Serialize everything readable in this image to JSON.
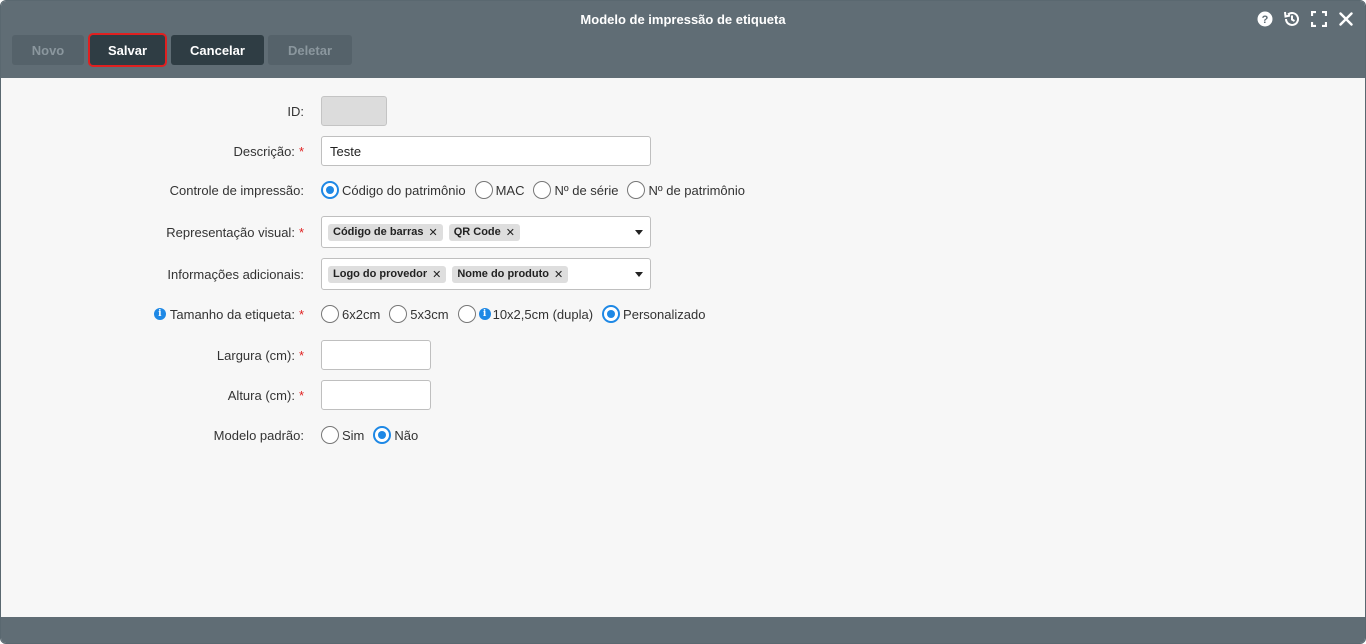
{
  "window": {
    "title": "Modelo de impressão de etiqueta",
    "icons": [
      "help-icon",
      "history-icon",
      "fullscreen-icon",
      "close-icon"
    ]
  },
  "toolbar": {
    "novo_label": "Novo",
    "salvar_label": "Salvar",
    "cancelar_label": "Cancelar",
    "deletar_label": "Deletar"
  },
  "form": {
    "id": {
      "label": "ID:",
      "value": ""
    },
    "descricao": {
      "label": "Descrição:",
      "required": "*",
      "value": "Teste"
    },
    "controle": {
      "label": "Controle de impressão:",
      "options": [
        "Código do patrimônio",
        "MAC",
        "Nº de série",
        "Nº de patrimônio"
      ],
      "selected": "Código do patrimônio"
    },
    "representacao": {
      "label": "Representação visual:",
      "required": "*",
      "tags": [
        "Código de barras",
        "QR Code"
      ],
      "remove_glyph": "✕"
    },
    "informacoes": {
      "label": "Informações adicionais:",
      "tags": [
        "Logo do provedor",
        "Nome do produto"
      ],
      "remove_glyph": "✕"
    },
    "tamanho": {
      "label": "Tamanho da etiqueta:",
      "required": "*",
      "info_glyph": "i",
      "options": [
        "6x2cm",
        "5x3cm",
        "10x2,5cm (dupla)",
        "Personalizado"
      ],
      "selected": "Personalizado"
    },
    "largura": {
      "label": "Largura (cm):",
      "required": "*",
      "value": ""
    },
    "altura": {
      "label": "Altura (cm):",
      "required": "*",
      "value": ""
    },
    "modelo_padrao": {
      "label": "Modelo padrão:",
      "options": [
        "Sim",
        "Não"
      ],
      "selected": "Não"
    }
  },
  "colors": {
    "header": "#606d75",
    "button_dark": "#2f3d44",
    "accent": "#1e88e5",
    "required": "#e02020",
    "highlight": "#e02020"
  }
}
